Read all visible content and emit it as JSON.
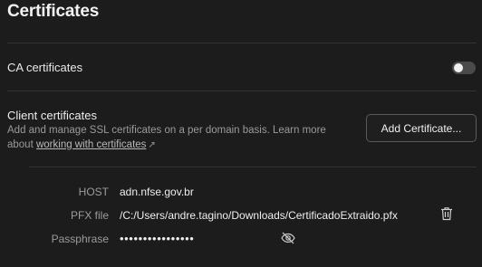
{
  "page": {
    "title": "Certificates"
  },
  "ca_certificates": {
    "label": "CA certificates",
    "enabled": false
  },
  "client_certificates": {
    "title": "Client certificates",
    "description": "Add and manage SSL certificates on a per domain basis. Learn more about",
    "link_text": "working with certificates",
    "link_icon": "↗",
    "add_button_label": "Add Certificate..."
  },
  "certificate": {
    "host_label": "HOST",
    "host_value": "adn.nfse.gov.br",
    "pfx_label": "PFX file",
    "pfx_value": "/C:/Users/andre.tagino/Downloads/CertificadoExtraido.pfx",
    "passphrase_label": "Passphrase",
    "passphrase_value": "••••••••••••••••"
  },
  "icons": {
    "delete": "trash-icon",
    "visibility": "eye-off-icon",
    "external_link": "external-link-icon"
  },
  "colors": {
    "background": "#1c1c1c",
    "divider": "#333333",
    "muted_text": "#9a9a9a"
  }
}
